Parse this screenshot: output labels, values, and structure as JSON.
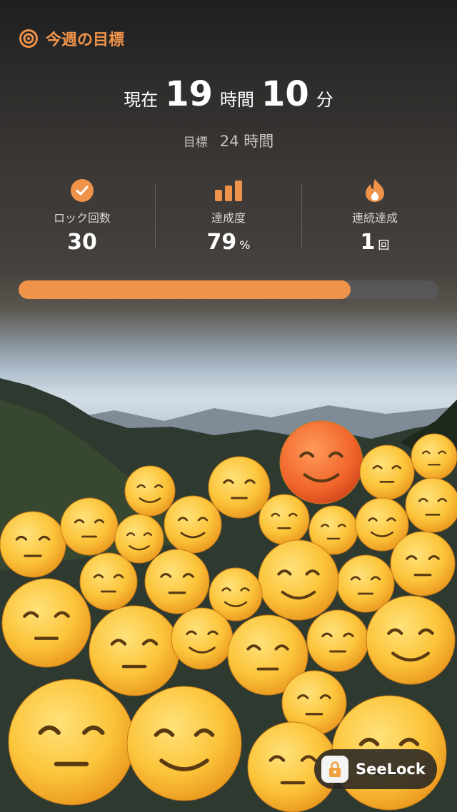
{
  "header": {
    "title": "今週の目標",
    "icon": "target-icon",
    "accent": "#f0934a"
  },
  "current": {
    "prefix": "現在",
    "hours": "19",
    "hours_unit": "時間",
    "minutes": "10",
    "minutes_unit": "分"
  },
  "goal": {
    "label": "目標",
    "value": "24 時間"
  },
  "stats": [
    {
      "icon": "check-circle-icon",
      "label": "ロック回数",
      "value": "30",
      "unit": ""
    },
    {
      "icon": "bar-chart-icon",
      "label": "達成度",
      "value": "79",
      "unit": "%"
    },
    {
      "icon": "flame-icon",
      "label": "連続達成",
      "value": "1",
      "unit": "回"
    }
  ],
  "progress": {
    "fraction": 0.79
  },
  "badge": {
    "label": "SeeLock",
    "icon": "lock-icon"
  }
}
